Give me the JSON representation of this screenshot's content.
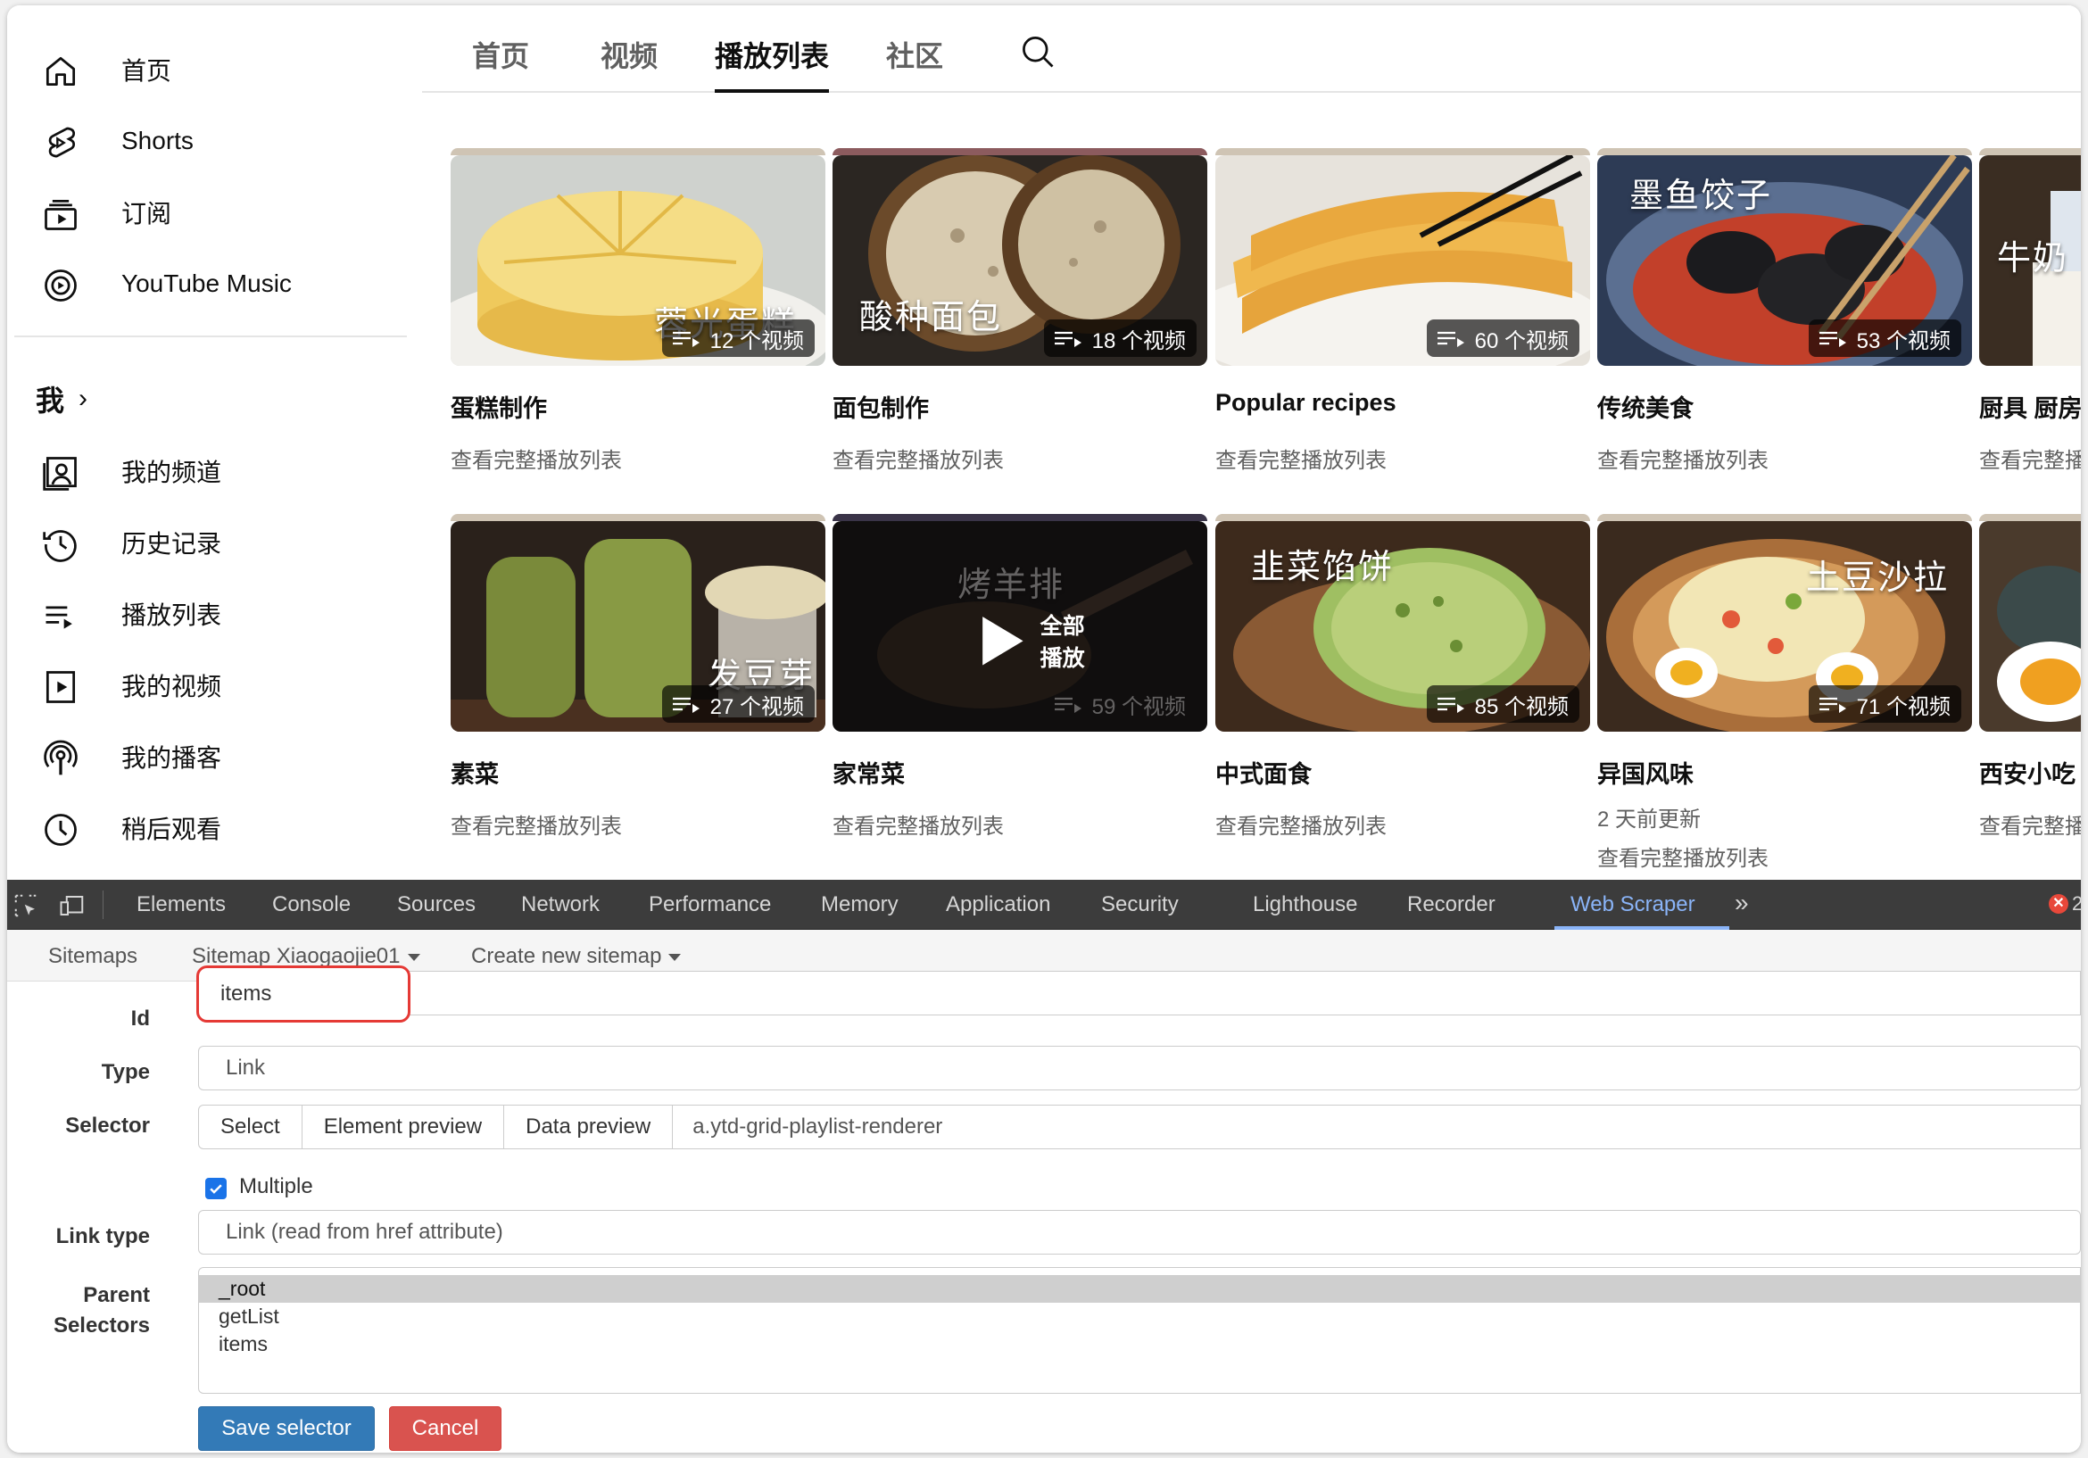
{
  "sidebar": {
    "items": [
      {
        "label": "首页",
        "icon": "home-icon"
      },
      {
        "label": "Shorts",
        "icon": "shorts-icon"
      },
      {
        "label": "订阅",
        "icon": "subscriptions-icon"
      },
      {
        "label": "YouTube Music",
        "icon": "youtube-music-icon"
      }
    ],
    "you_heading": "我",
    "you_chevron": "›",
    "you_items": [
      {
        "label": "我的频道",
        "icon": "your-channel-icon"
      },
      {
        "label": "历史记录",
        "icon": "history-icon"
      },
      {
        "label": "播放列表",
        "icon": "playlists-icon"
      },
      {
        "label": "我的视频",
        "icon": "your-videos-icon"
      },
      {
        "label": "我的播客",
        "icon": "podcasts-icon"
      },
      {
        "label": "稍后观看",
        "icon": "watch-later-icon"
      }
    ]
  },
  "channel_tabs": {
    "tabs": [
      "首页",
      "视频",
      "播放列表",
      "社区"
    ],
    "active": "播放列表",
    "search_icon": "search-icon"
  },
  "playlists": [
    {
      "title": "蛋糕制作",
      "count": "12 个视频",
      "sub": "查看完整播放列表",
      "overlay": "蓉光蛋糕"
    },
    {
      "title": "面包制作",
      "count": "18 个视频",
      "sub": "查看完整播放列表",
      "overlay": "酸种面包"
    },
    {
      "title": "Popular recipes",
      "count": "60 个视频",
      "sub": "查看完整播放列表",
      "overlay": ""
    },
    {
      "title": "传统美食",
      "count": "53 个视频",
      "sub": "查看完整播放列表",
      "overlay": "墨鱼饺子"
    },
    {
      "title": "厨具 厨房",
      "count": "",
      "sub": "查看完整播",
      "overlay": "牛奶"
    },
    {
      "title": "素菜",
      "count": "27 个视频",
      "sub": "查看完整播放列表",
      "overlay": "发豆芽"
    },
    {
      "title": "家常菜",
      "count": "59 个视频",
      "sub": "查看完整播放列表",
      "overlay": "烤羊排",
      "hover_label": "全部播放"
    },
    {
      "title": "中式面食",
      "count": "85 个视频",
      "sub": "查看完整播放列表",
      "overlay": "韭菜馅饼"
    },
    {
      "title": "异国风味",
      "count": "71 个视频",
      "updated": "2 天前更新",
      "sub": "查看完整播放列表",
      "overlay": "土豆沙拉"
    },
    {
      "title": "西安小吃",
      "count": "",
      "sub": "查看完整播",
      "overlay": ""
    }
  ],
  "devtools": {
    "tabs": [
      "Elements",
      "Console",
      "Sources",
      "Network",
      "Performance",
      "Memory",
      "Application",
      "Security",
      "Lighthouse",
      "Recorder",
      "Web Scraper"
    ],
    "active_tab": "Web Scraper",
    "more": "»",
    "error_count": "2",
    "toolbar_icons": [
      "inspect-element-icon",
      "device-toolbar-icon"
    ]
  },
  "web_scraper": {
    "nav": {
      "sitemaps": "Sitemaps",
      "sitemap": "Sitemap Xiaogaojie01",
      "create": "Create new sitemap"
    },
    "form": {
      "id_label": "Id",
      "id_value": "items",
      "type_label": "Type",
      "type_value": "Link",
      "selector_label": "Selector",
      "select_btn": "Select",
      "element_preview_btn": "Element preview",
      "data_preview_btn": "Data preview",
      "selector_value": "a.ytd-grid-playlist-renderer",
      "multiple_label": "Multiple",
      "multiple_checked": true,
      "link_type_label": "Link type",
      "link_type_value": "Link (read from href attribute)",
      "parent_label_1": "Parent",
      "parent_label_2": "Selectors",
      "parent_options": [
        "_root",
        "getList",
        "items"
      ],
      "parent_selected": "_root",
      "save_btn": "Save selector",
      "cancel_btn": "Cancel"
    }
  },
  "colors": {
    "devtools_bg": "#3c3c3c",
    "devtools_active": "#8ab4f8",
    "save_button": "#337ab7",
    "cancel_button": "#d9534f",
    "highlight_border": "#e53935"
  }
}
